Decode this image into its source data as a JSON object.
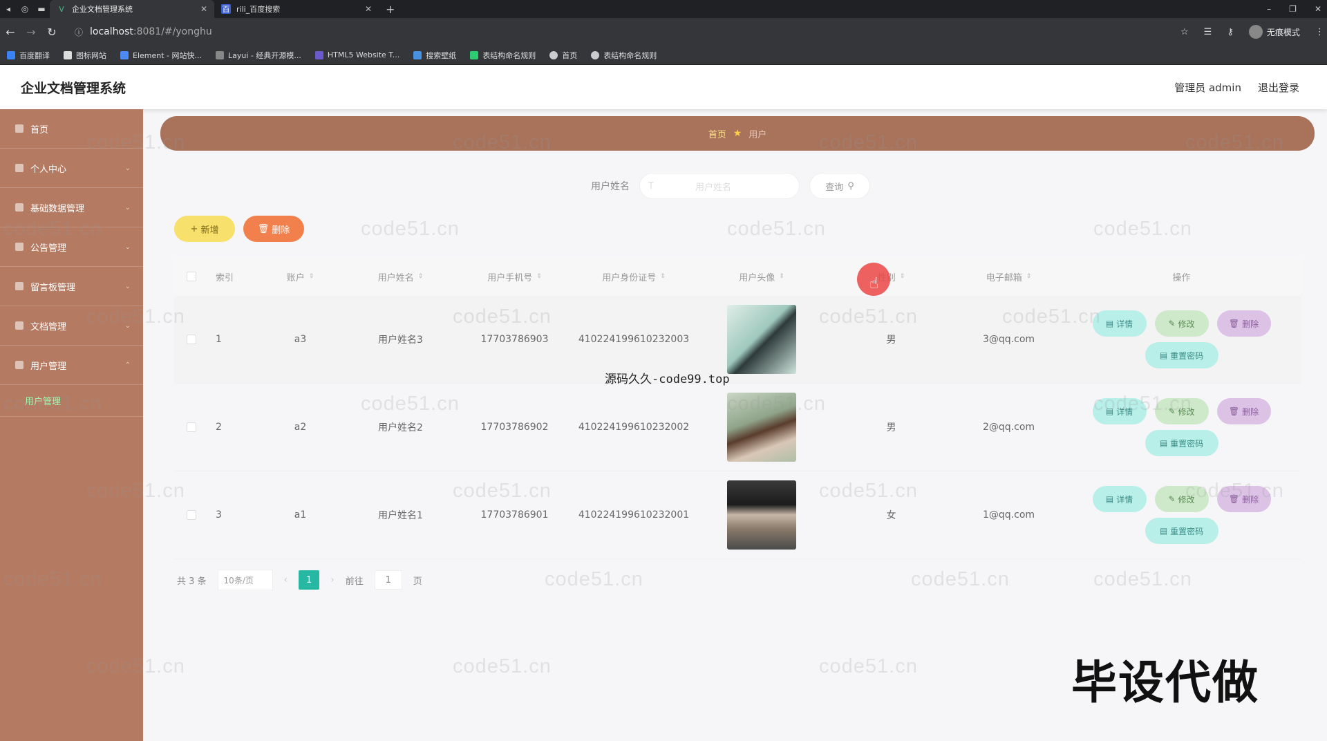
{
  "browser": {
    "tabs": [
      {
        "title": "企业文档管理系统",
        "active": true
      },
      {
        "title": "rili_百度搜索",
        "active": false
      }
    ],
    "url_host": "localhost",
    "url_rest": ":8081/#/yonghu",
    "incognito_label": "无痕模式",
    "bookmarks": [
      "百度翻译",
      "图标网站",
      "Element - 网站快...",
      "Layui - 经典开源模...",
      "HTML5 Website T...",
      "搜索壁纸",
      "表结构命名规则",
      "首页",
      "表结构命名规则"
    ]
  },
  "app": {
    "title": "企业文档管理系统",
    "user_label": "管理员 admin",
    "logout_label": "退出登录"
  },
  "sidebar": {
    "items": [
      {
        "label": "首页"
      },
      {
        "label": "个人中心"
      },
      {
        "label": "基础数据管理"
      },
      {
        "label": "公告管理"
      },
      {
        "label": "留言板管理"
      },
      {
        "label": "文档管理"
      },
      {
        "label": "用户管理"
      }
    ],
    "sub_active": "用户管理"
  },
  "breadcrumb": {
    "home": "首页",
    "current": "用户"
  },
  "search": {
    "label": "用户姓名",
    "input_prefix": "T",
    "placeholder": "用户姓名",
    "button": "查询"
  },
  "actions": {
    "add": "新增",
    "delete": "删除"
  },
  "table": {
    "headers": [
      "索引",
      "账户",
      "用户姓名",
      "用户手机号",
      "用户身份证号",
      "用户头像",
      "性别",
      "电子邮箱",
      "操作"
    ],
    "rows": [
      {
        "index": "1",
        "account": "a3",
        "name": "用户姓名3",
        "phone": "17703786903",
        "idcard": "410224199610232003",
        "sex": "男",
        "email": "3@qq.com"
      },
      {
        "index": "2",
        "account": "a2",
        "name": "用户姓名2",
        "phone": "17703786902",
        "idcard": "410224199610232002",
        "sex": "男",
        "email": "2@qq.com"
      },
      {
        "index": "3",
        "account": "a1",
        "name": "用户姓名1",
        "phone": "17703786901",
        "idcard": "410224199610232001",
        "sex": "女",
        "email": "1@qq.com"
      }
    ],
    "op_labels": {
      "detail": "详情",
      "edit": "修改",
      "delete": "删除",
      "reset": "重置密码"
    }
  },
  "pager": {
    "total": "共 3 条",
    "page_size": "10条/页",
    "current": "1",
    "goto_label": "前往",
    "goto_value": "1",
    "page_unit": "页"
  },
  "overlay": {
    "watermark": "code51.cn",
    "site_text": "源码久久-code99.top",
    "big_text": "毕设代做"
  },
  "colors": {
    "sidebar": "#b47a62",
    "breadcrumb": "#a8725b",
    "primary": "#26b8a2",
    "add": "#f7e06b",
    "delete": "#f2804d"
  }
}
